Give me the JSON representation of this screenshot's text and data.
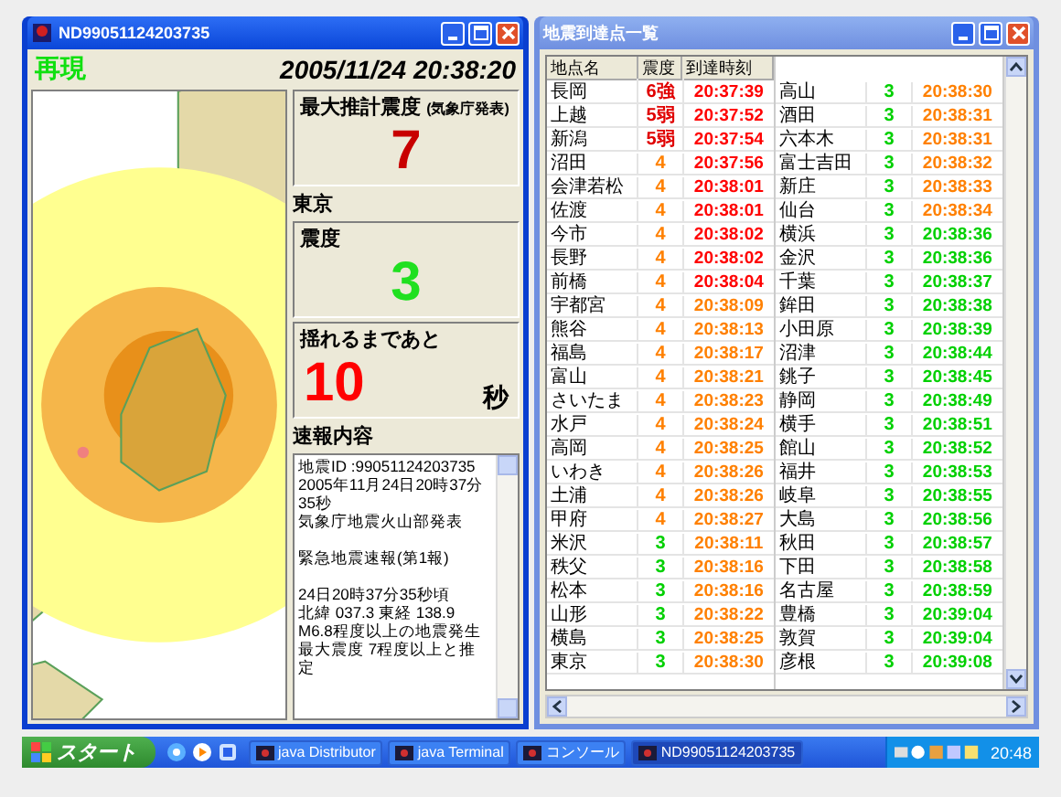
{
  "main_window": {
    "title": "ND99051124203735",
    "mode": "再現",
    "datetime": "2005/11/24 20:38:20",
    "max_intensity": {
      "label": "最大推計震度",
      "note": "(気象庁発表)",
      "value": "7"
    },
    "location": "東京",
    "local_intensity": {
      "label": "震度",
      "value": "3"
    },
    "countdown": {
      "label": "揺れるまであと",
      "value": "10",
      "unit": "秒"
    },
    "report": {
      "label": "速報内容",
      "paragraphs": [
        [
          "地震ID :99051124203735",
          "2005年11月24日20時37分35秒",
          "気象庁地震火山部発表"
        ],
        [
          "緊急地震速報(第1報)"
        ],
        [
          "24日20時37分35秒頃",
          "北緯 037.3 東経 138.9",
          "M6.8程度以上の地震発生",
          "最大震度 7程度以上と推定"
        ]
      ]
    }
  },
  "list_window": {
    "title": "地震到達点一覧",
    "columns": [
      "地点名",
      "震度",
      "到達時刻"
    ],
    "rows": [
      {
        "name": "長岡",
        "intensity": {
          "text": "6強",
          "color": "#e00000"
        },
        "time": {
          "text": "20:37:39",
          "color": "#ff0000"
        }
      },
      {
        "name": "上越",
        "intensity": {
          "text": "5弱",
          "color": "#e00000"
        },
        "time": {
          "text": "20:37:52",
          "color": "#ff0000"
        }
      },
      {
        "name": "新潟",
        "intensity": {
          "text": "5弱",
          "color": "#e00000"
        },
        "time": {
          "text": "20:37:54",
          "color": "#ff0000"
        }
      },
      {
        "name": "沼田",
        "intensity": {
          "text": "4",
          "color": "#ff8000"
        },
        "time": {
          "text": "20:37:56",
          "color": "#ff0000"
        }
      },
      {
        "name": "会津若松",
        "intensity": {
          "text": "4",
          "color": "#ff8000"
        },
        "time": {
          "text": "20:38:01",
          "color": "#ff0000"
        }
      },
      {
        "name": "佐渡",
        "intensity": {
          "text": "4",
          "color": "#ff8000"
        },
        "time": {
          "text": "20:38:01",
          "color": "#ff0000"
        }
      },
      {
        "name": "今市",
        "intensity": {
          "text": "4",
          "color": "#ff8000"
        },
        "time": {
          "text": "20:38:02",
          "color": "#ff0000"
        }
      },
      {
        "name": "長野",
        "intensity": {
          "text": "4",
          "color": "#ff8000"
        },
        "time": {
          "text": "20:38:02",
          "color": "#ff0000"
        }
      },
      {
        "name": "前橋",
        "intensity": {
          "text": "4",
          "color": "#ff8000"
        },
        "time": {
          "text": "20:38:04",
          "color": "#ff0000"
        }
      },
      {
        "name": "宇都宮",
        "intensity": {
          "text": "4",
          "color": "#ff8000"
        },
        "time": {
          "text": "20:38:09",
          "color": "#ff8000"
        }
      },
      {
        "name": "熊谷",
        "intensity": {
          "text": "4",
          "color": "#ff8000"
        },
        "time": {
          "text": "20:38:13",
          "color": "#ff8000"
        }
      },
      {
        "name": "福島",
        "intensity": {
          "text": "4",
          "color": "#ff8000"
        },
        "time": {
          "text": "20:38:17",
          "color": "#ff8000"
        }
      },
      {
        "name": "富山",
        "intensity": {
          "text": "4",
          "color": "#ff8000"
        },
        "time": {
          "text": "20:38:21",
          "color": "#ff8000"
        }
      },
      {
        "name": "さいたま",
        "intensity": {
          "text": "4",
          "color": "#ff8000"
        },
        "time": {
          "text": "20:38:23",
          "color": "#ff8000"
        }
      },
      {
        "name": "水戸",
        "intensity": {
          "text": "4",
          "color": "#ff8000"
        },
        "time": {
          "text": "20:38:24",
          "color": "#ff8000"
        }
      },
      {
        "name": "高岡",
        "intensity": {
          "text": "4",
          "color": "#ff8000"
        },
        "time": {
          "text": "20:38:25",
          "color": "#ff8000"
        }
      },
      {
        "name": "いわき",
        "intensity": {
          "text": "4",
          "color": "#ff8000"
        },
        "time": {
          "text": "20:38:26",
          "color": "#ff8000"
        }
      },
      {
        "name": "土浦",
        "intensity": {
          "text": "4",
          "color": "#ff8000"
        },
        "time": {
          "text": "20:38:26",
          "color": "#ff8000"
        }
      },
      {
        "name": "甲府",
        "intensity": {
          "text": "4",
          "color": "#ff8000"
        },
        "time": {
          "text": "20:38:27",
          "color": "#ff8000"
        }
      },
      {
        "name": "米沢",
        "intensity": {
          "text": "3",
          "color": "#00d000"
        },
        "time": {
          "text": "20:38:11",
          "color": "#ff8000"
        }
      },
      {
        "name": "秩父",
        "intensity": {
          "text": "3",
          "color": "#00d000"
        },
        "time": {
          "text": "20:38:16",
          "color": "#ff8000"
        }
      },
      {
        "name": "松本",
        "intensity": {
          "text": "3",
          "color": "#00d000"
        },
        "time": {
          "text": "20:38:16",
          "color": "#ff8000"
        }
      },
      {
        "name": "山形",
        "intensity": {
          "text": "3",
          "color": "#00d000"
        },
        "time": {
          "text": "20:38:22",
          "color": "#ff8000"
        }
      },
      {
        "name": "横島",
        "intensity": {
          "text": "3",
          "color": "#00d000"
        },
        "time": {
          "text": "20:38:25",
          "color": "#ff8000"
        }
      },
      {
        "name": "東京",
        "intensity": {
          "text": "3",
          "color": "#00d000"
        },
        "time": {
          "text": "20:38:30",
          "color": "#ff8000"
        }
      },
      {
        "name": "高山",
        "intensity": {
          "text": "3",
          "color": "#00d000"
        },
        "time": {
          "text": "20:38:30",
          "color": "#ff8000"
        }
      },
      {
        "name": "酒田",
        "intensity": {
          "text": "3",
          "color": "#00d000"
        },
        "time": {
          "text": "20:38:31",
          "color": "#ff8000"
        }
      },
      {
        "name": "六本木",
        "intensity": {
          "text": "3",
          "color": "#00d000"
        },
        "time": {
          "text": "20:38:31",
          "color": "#ff8000"
        }
      },
      {
        "name": "富士吉田",
        "intensity": {
          "text": "3",
          "color": "#00d000"
        },
        "time": {
          "text": "20:38:32",
          "color": "#ff8000"
        }
      },
      {
        "name": "新庄",
        "intensity": {
          "text": "3",
          "color": "#00d000"
        },
        "time": {
          "text": "20:38:33",
          "color": "#ff8000"
        }
      },
      {
        "name": "仙台",
        "intensity": {
          "text": "3",
          "color": "#00d000"
        },
        "time": {
          "text": "20:38:34",
          "color": "#ff8000"
        }
      },
      {
        "name": "横浜",
        "intensity": {
          "text": "3",
          "color": "#00d000"
        },
        "time": {
          "text": "20:38:36",
          "color": "#00d000"
        }
      },
      {
        "name": "金沢",
        "intensity": {
          "text": "3",
          "color": "#00d000"
        },
        "time": {
          "text": "20:38:36",
          "color": "#00d000"
        }
      },
      {
        "name": "千葉",
        "intensity": {
          "text": "3",
          "color": "#00d000"
        },
        "time": {
          "text": "20:38:37",
          "color": "#00d000"
        }
      },
      {
        "name": "鉾田",
        "intensity": {
          "text": "3",
          "color": "#00d000"
        },
        "time": {
          "text": "20:38:38",
          "color": "#00d000"
        }
      },
      {
        "name": "小田原",
        "intensity": {
          "text": "3",
          "color": "#00d000"
        },
        "time": {
          "text": "20:38:39",
          "color": "#00d000"
        }
      },
      {
        "name": "沼津",
        "intensity": {
          "text": "3",
          "color": "#00d000"
        },
        "time": {
          "text": "20:38:44",
          "color": "#00d000"
        }
      },
      {
        "name": "銚子",
        "intensity": {
          "text": "3",
          "color": "#00d000"
        },
        "time": {
          "text": "20:38:45",
          "color": "#00d000"
        }
      },
      {
        "name": "静岡",
        "intensity": {
          "text": "3",
          "color": "#00d000"
        },
        "time": {
          "text": "20:38:49",
          "color": "#00d000"
        }
      },
      {
        "name": "横手",
        "intensity": {
          "text": "3",
          "color": "#00d000"
        },
        "time": {
          "text": "20:38:51",
          "color": "#00d000"
        }
      },
      {
        "name": "館山",
        "intensity": {
          "text": "3",
          "color": "#00d000"
        },
        "time": {
          "text": "20:38:52",
          "color": "#00d000"
        }
      },
      {
        "name": "福井",
        "intensity": {
          "text": "3",
          "color": "#00d000"
        },
        "time": {
          "text": "20:38:53",
          "color": "#00d000"
        }
      },
      {
        "name": "岐阜",
        "intensity": {
          "text": "3",
          "color": "#00d000"
        },
        "time": {
          "text": "20:38:55",
          "color": "#00d000"
        }
      },
      {
        "name": "大島",
        "intensity": {
          "text": "3",
          "color": "#00d000"
        },
        "time": {
          "text": "20:38:56",
          "color": "#00d000"
        }
      },
      {
        "name": "秋田",
        "intensity": {
          "text": "3",
          "color": "#00d000"
        },
        "time": {
          "text": "20:38:57",
          "color": "#00d000"
        }
      },
      {
        "name": "下田",
        "intensity": {
          "text": "3",
          "color": "#00d000"
        },
        "time": {
          "text": "20:38:58",
          "color": "#00d000"
        }
      },
      {
        "name": "名古屋",
        "intensity": {
          "text": "3",
          "color": "#00d000"
        },
        "time": {
          "text": "20:38:59",
          "color": "#00d000"
        }
      },
      {
        "name": "豊橋",
        "intensity": {
          "text": "3",
          "color": "#00d000"
        },
        "time": {
          "text": "20:39:04",
          "color": "#00d000"
        }
      },
      {
        "name": "敦賀",
        "intensity": {
          "text": "3",
          "color": "#00d000"
        },
        "time": {
          "text": "20:39:04",
          "color": "#00d000"
        }
      },
      {
        "name": "彦根",
        "intensity": {
          "text": "3",
          "color": "#00d000"
        },
        "time": {
          "text": "20:39:08",
          "color": "#00d000"
        }
      }
    ]
  },
  "taskbar": {
    "start": "スタート",
    "tasks": [
      {
        "label": "java Distributor",
        "selected": false
      },
      {
        "label": "java Terminal",
        "selected": false
      },
      {
        "label": "コンソール",
        "selected": false
      },
      {
        "label": "ND99051124203735",
        "selected": true
      }
    ],
    "clock": "20:48"
  }
}
